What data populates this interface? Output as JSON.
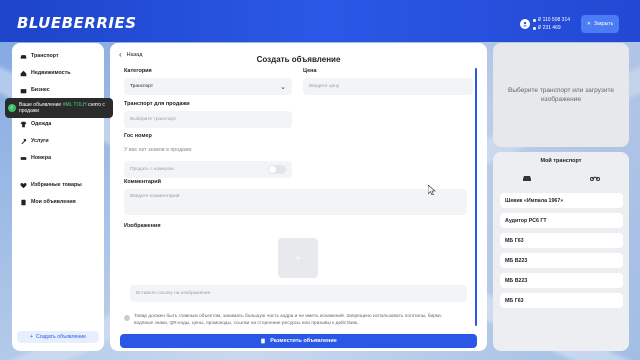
{
  "header": {
    "logo": "BLUEBERRIES",
    "balance_1": "₽ 110 508 314",
    "balance_2": "₽ 231 469",
    "close_label": "Закрыть"
  },
  "sidebar": {
    "items": [
      {
        "label": "Транспорт",
        "icon": "car-icon"
      },
      {
        "label": "Недвижимость",
        "icon": "house-icon"
      },
      {
        "label": "Бизнес",
        "icon": "business-icon"
      },
      {
        "label": "Одежда",
        "icon": "shirt-icon"
      },
      {
        "label": "Услуги",
        "icon": "service-icon"
      },
      {
        "label": "Номера",
        "icon": "plate-icon"
      },
      {
        "label": "Избранные товары",
        "icon": "heart-icon"
      },
      {
        "label": "Мои объявления",
        "icon": "list-icon"
      }
    ],
    "add_label": "Создать объявление"
  },
  "toast": {
    "text_before": "Ваше объявление",
    "highlight": "#ML TOLH",
    "text_after": "снято с продажи"
  },
  "form": {
    "back_label": "Назад",
    "title": "Создать объявление",
    "category_label": "Категория",
    "category_value": "Транспорт",
    "price_label": "Цена",
    "price_placeholder": "Введите цену",
    "transport_label": "Транспорт для продажи",
    "transport_placeholder": "Выберите транспорт",
    "gos_label": "Гос номер",
    "gos_empty": "У вас нет знаков в продаже",
    "gos_toggle_label": "Продать с номером",
    "comment_label": "Комментарий",
    "comment_placeholder": "Введите комментарий",
    "images_label": "Изображения",
    "image_url_placeholder": "Вставьте ссылку на изображение",
    "info_text": "Товар должен быть главным объектом, занимать большую часть кадра и не иметь искажений. Запрещено использовать логотипы, бирки, водяные знаки, QR-коды, цены, промокоды, ссылки на сторонние ресурсы или призывы к действию.",
    "submit_label": "Разместить объявление"
  },
  "preview": {
    "text": "Выберите транспорт или загрузите изображение"
  },
  "my_transport": {
    "title": "Мой транспорт",
    "vehicles": [
      "Шевик «Импала 1967»",
      "Аудитор РС6 ГТ",
      "МБ Г63",
      "МБ В223",
      "МБ В223",
      "МБ Г63"
    ]
  },
  "colors": {
    "brand": "#2a58e6",
    "header": "#1d44c9",
    "success": "#3bbf6a"
  }
}
